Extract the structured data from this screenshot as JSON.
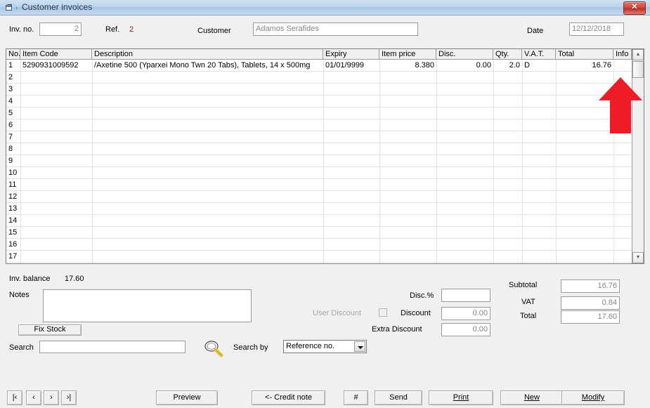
{
  "window": {
    "title": "Customer invoices",
    "icon": "window-restore-icon",
    "breadcrumb_arrow": "›",
    "close_label": "✕"
  },
  "header": {
    "inv_no_label": "Inv. no.",
    "inv_no_value": "2",
    "ref_label": "Ref.",
    "ref_value": "2",
    "ref_color": "#8b1a1a",
    "customer_label": "Customer",
    "customer_value": "Adamos Serafides",
    "date_label": "Date",
    "date_value": "12/12/2018"
  },
  "grid": {
    "columns": [
      {
        "key": "no",
        "label": "No.",
        "align": "left"
      },
      {
        "key": "item_code",
        "label": "Item Code",
        "align": "left"
      },
      {
        "key": "description",
        "label": "Description",
        "align": "left"
      },
      {
        "key": "expiry",
        "label": "Expiry",
        "align": "left"
      },
      {
        "key": "item_price",
        "label": "Item price",
        "align": "right"
      },
      {
        "key": "disc",
        "label": "Disc.",
        "align": "right"
      },
      {
        "key": "qty",
        "label": "Qty.",
        "align": "right"
      },
      {
        "key": "vat",
        "label": "V.A.T.",
        "align": "left"
      },
      {
        "key": "total",
        "label": "Total",
        "align": "right"
      },
      {
        "key": "info",
        "label": "Info",
        "align": "left"
      }
    ],
    "rows": [
      {
        "no": "1",
        "item_code": "5290931009592",
        "description": "/Axetine 500 (Yparxei Mono Twn 20 Tabs), Tablets, 14 x 500mg",
        "expiry": "01/01/9999",
        "item_price": "8.380",
        "disc": "0.00",
        "qty": "2.0",
        "vat": "D",
        "total": "16.76",
        "info": ""
      },
      {
        "no": "2",
        "item_code": "",
        "description": "",
        "expiry": "",
        "item_price": "",
        "disc": "",
        "qty": "",
        "vat": "",
        "total": "",
        "info": ""
      },
      {
        "no": "3",
        "item_code": "",
        "description": "",
        "expiry": "",
        "item_price": "",
        "disc": "",
        "qty": "",
        "vat": "",
        "total": "",
        "info": ""
      },
      {
        "no": "4",
        "item_code": "",
        "description": "",
        "expiry": "",
        "item_price": "",
        "disc": "",
        "qty": "",
        "vat": "",
        "total": "",
        "info": ""
      },
      {
        "no": "5",
        "item_code": "",
        "description": "",
        "expiry": "",
        "item_price": "",
        "disc": "",
        "qty": "",
        "vat": "",
        "total": "",
        "info": ""
      },
      {
        "no": "6",
        "item_code": "",
        "description": "",
        "expiry": "",
        "item_price": "",
        "disc": "",
        "qty": "",
        "vat": "",
        "total": "",
        "info": ""
      },
      {
        "no": "7",
        "item_code": "",
        "description": "",
        "expiry": "",
        "item_price": "",
        "disc": "",
        "qty": "",
        "vat": "",
        "total": "",
        "info": ""
      },
      {
        "no": "8",
        "item_code": "",
        "description": "",
        "expiry": "",
        "item_price": "",
        "disc": "",
        "qty": "",
        "vat": "",
        "total": "",
        "info": ""
      },
      {
        "no": "9",
        "item_code": "",
        "description": "",
        "expiry": "",
        "item_price": "",
        "disc": "",
        "qty": "",
        "vat": "",
        "total": "",
        "info": ""
      },
      {
        "no": "10",
        "item_code": "",
        "description": "",
        "expiry": "",
        "item_price": "",
        "disc": "",
        "qty": "",
        "vat": "",
        "total": "",
        "info": ""
      },
      {
        "no": "11",
        "item_code": "",
        "description": "",
        "expiry": "",
        "item_price": "",
        "disc": "",
        "qty": "",
        "vat": "",
        "total": "",
        "info": ""
      },
      {
        "no": "12",
        "item_code": "",
        "description": "",
        "expiry": "",
        "item_price": "",
        "disc": "",
        "qty": "",
        "vat": "",
        "total": "",
        "info": ""
      },
      {
        "no": "13",
        "item_code": "",
        "description": "",
        "expiry": "",
        "item_price": "",
        "disc": "",
        "qty": "",
        "vat": "",
        "total": "",
        "info": ""
      },
      {
        "no": "14",
        "item_code": "",
        "description": "",
        "expiry": "",
        "item_price": "",
        "disc": "",
        "qty": "",
        "vat": "",
        "total": "",
        "info": ""
      },
      {
        "no": "15",
        "item_code": "",
        "description": "",
        "expiry": "",
        "item_price": "",
        "disc": "",
        "qty": "",
        "vat": "",
        "total": "",
        "info": ""
      },
      {
        "no": "16",
        "item_code": "",
        "description": "",
        "expiry": "",
        "item_price": "",
        "disc": "",
        "qty": "",
        "vat": "",
        "total": "",
        "info": ""
      },
      {
        "no": "17",
        "item_code": "",
        "description": "",
        "expiry": "",
        "item_price": "",
        "disc": "",
        "qty": "",
        "vat": "",
        "total": "",
        "info": ""
      }
    ],
    "scrollbar": {
      "up_arrow": "▲",
      "down_arrow": "▼"
    }
  },
  "annotation": {
    "arrow": "red-up-arrow",
    "color": "#ee1c25"
  },
  "footer": {
    "inv_balance_label": "Inv. balance",
    "inv_balance_value": "17.60",
    "notes_label": "Notes",
    "notes_value": "",
    "fix_stock_label": "Fix Stock",
    "search_label": "Search",
    "search_value": "",
    "magnifier_icon": "magnifier-icon",
    "search_by_label": "Search by",
    "search_by_value": "Reference no.",
    "search_by_options": [
      "Reference no."
    ],
    "disc_pct_label": "Disc.%",
    "disc_pct_value": "",
    "user_discount_label": "User Discount",
    "user_discount_checked": false,
    "discount_label": "Discount",
    "discount_value": "0.00",
    "extra_discount_label": "Extra Discount",
    "extra_discount_value": "0.00",
    "subtotal_label": "Subtotal",
    "subtotal_value": "16.76",
    "vat_label": "VAT",
    "vat_value": "0.84",
    "total_label": "Total",
    "total_value": "17.60"
  },
  "buttons": {
    "nav_first": "|‹",
    "nav_prev": "‹",
    "nav_next": "›",
    "nav_last": "›|",
    "preview": "Preview",
    "credit_note": "<- Credit note",
    "hash": "#",
    "send": "Send",
    "print": "Print",
    "new": "New",
    "modify": "Modify"
  }
}
